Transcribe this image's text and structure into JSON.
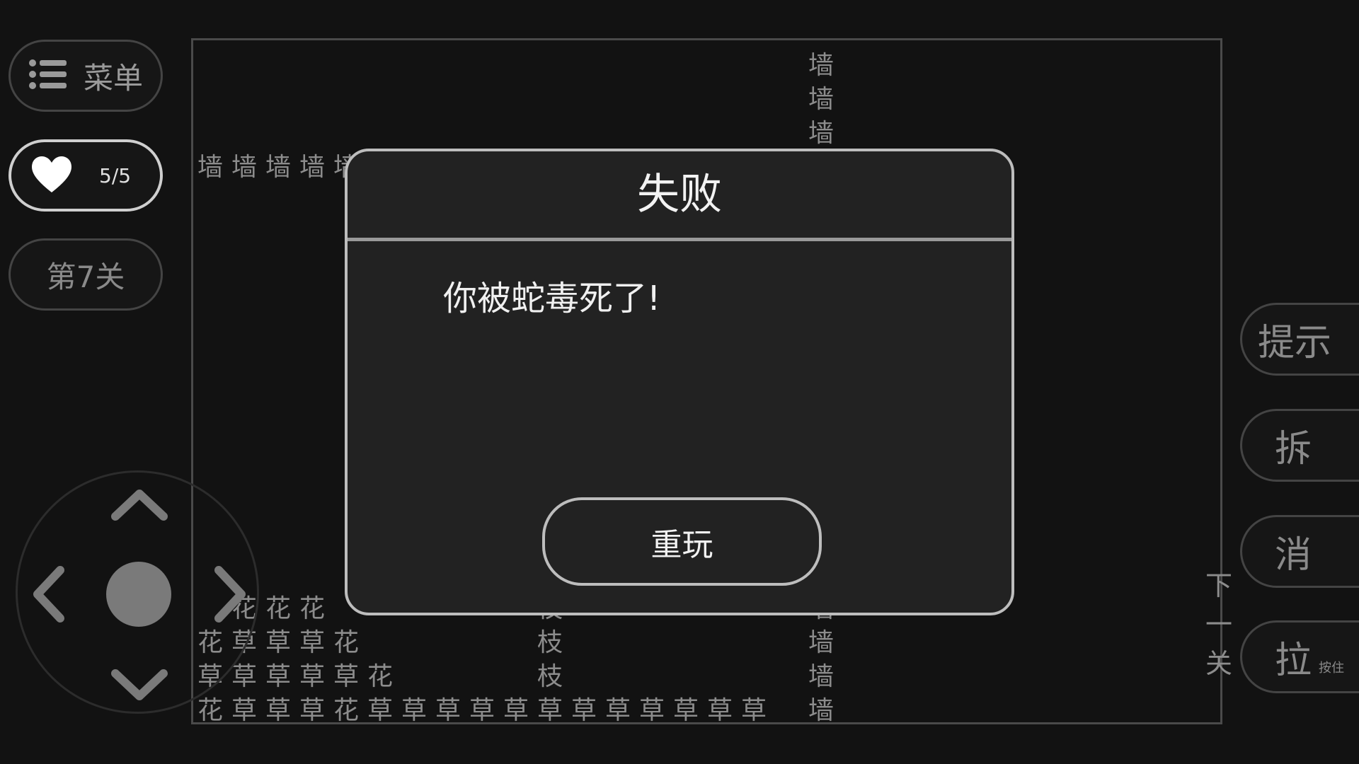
{
  "menu": {
    "label": "菜单",
    "icon": "list-icon"
  },
  "lives": {
    "count": "5/5",
    "icon": "heart-icon"
  },
  "level": {
    "label": "第7关"
  },
  "board": {
    "wall_top_col": [
      "墙",
      "墙",
      "墙"
    ],
    "wall_top_row": [
      "墙",
      "墙",
      "墙",
      "墙",
      "墙"
    ],
    "next_level": "下一关",
    "flower_row1": [
      "花",
      "花",
      "花"
    ],
    "row2": [
      "花",
      "草",
      "草",
      "草",
      "花"
    ],
    "row3": [
      "草",
      "草",
      "草",
      "草",
      "草",
      "花"
    ],
    "row4": [
      "花",
      "草",
      "草",
      "草",
      "花",
      "草",
      "草",
      "草",
      "草",
      "草",
      "草",
      "草",
      "草",
      "草",
      "草",
      "草",
      "草"
    ],
    "branch_col": [
      "枝",
      "枝",
      "枝"
    ],
    "wall_bottom_col": [
      "墙",
      "墙",
      "墙",
      "墙"
    ]
  },
  "actions": {
    "hint": "提示",
    "demolish": "拆",
    "erase": "消",
    "pull": "拉",
    "pull_sub": "按住"
  },
  "dialog": {
    "title": "失败",
    "message": "你被蛇毒死了!",
    "replay": "重玩"
  }
}
